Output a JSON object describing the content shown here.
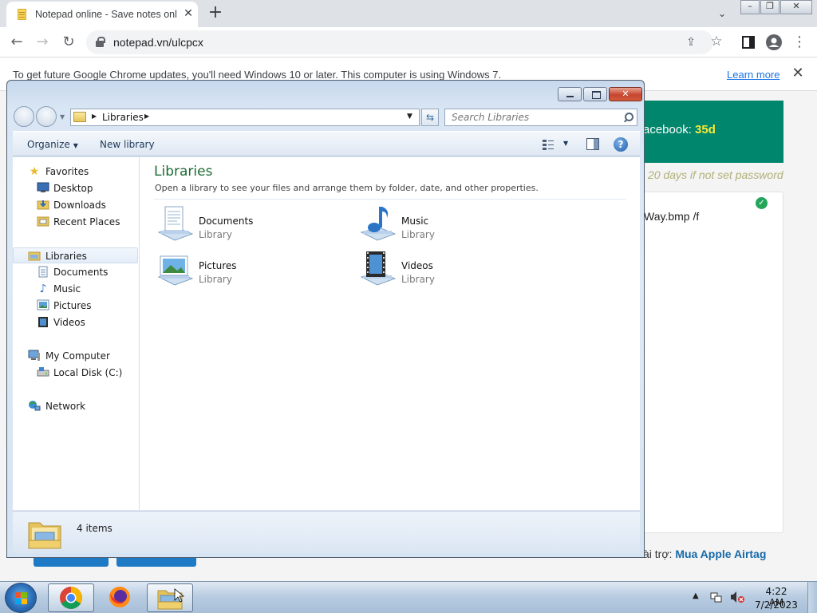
{
  "browser": {
    "tab_title": "Notepad online - Save notes onl",
    "tab_close": "✕",
    "new_tab": "+",
    "url": "notepad.vn/ulcpcx",
    "infobar_text": "To get future Google Chrome updates, you'll need Windows 10 or later. This computer is using Windows 7.",
    "infobar_link": "Learn more",
    "infobar_close": "✕"
  },
  "webpage": {
    "facebook_label": "acebook: ",
    "facebook_value": "35d",
    "days_text": "20 days if not set password",
    "editor_text": "Way.bmp /f",
    "sponsor_label": "ài trợ: ",
    "sponsor_link": "Mua Apple Airtag",
    "colors": {
      "green_box": "#00866c",
      "highlight": "#f7ea3a",
      "button": "#1e7ac4",
      "link": "#1669a9"
    }
  },
  "explorer": {
    "address": "Libraries",
    "search_placeholder": "Search Libraries",
    "organize": "Organize",
    "new_library": "New library",
    "title": "Libraries",
    "subtitle": "Open a library to see your files and arrange them by folder, date, and other properties.",
    "nav": {
      "favorites": "Favorites",
      "desktop": "Desktop",
      "downloads": "Downloads",
      "recent_places": "Recent Places",
      "libraries": "Libraries",
      "documents": "Documents",
      "music": "Music",
      "pictures": "Pictures",
      "videos": "Videos",
      "my_computer": "My Computer",
      "local_disk": "Local Disk (C:)",
      "network": "Network"
    },
    "libraries": [
      {
        "name": "Documents",
        "type": "Library",
        "icon": "documents-library-icon"
      },
      {
        "name": "Music",
        "type": "Library",
        "icon": "music-library-icon"
      },
      {
        "name": "Pictures",
        "type": "Library",
        "icon": "pictures-library-icon"
      },
      {
        "name": "Videos",
        "type": "Library",
        "icon": "videos-library-icon"
      }
    ],
    "item_count": "4 items"
  },
  "taskbar": {
    "time": "4:22 AM",
    "date": "7/2/2023"
  }
}
